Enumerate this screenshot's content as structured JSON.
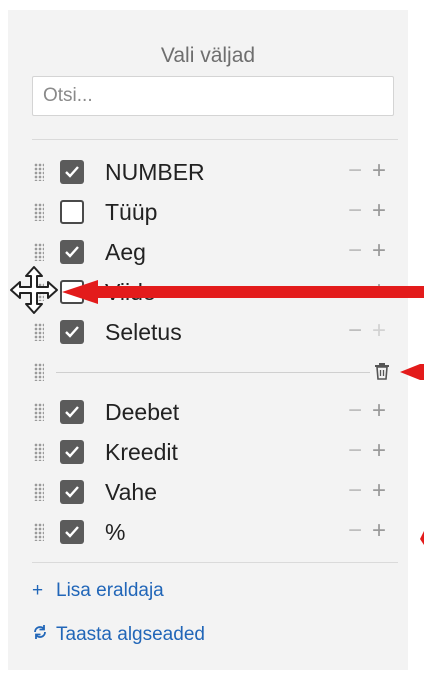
{
  "panel": {
    "title": "Vali väljad",
    "search_placeholder": "Otsi..."
  },
  "fields": [
    {
      "label": "NUMBER",
      "checked": true
    },
    {
      "label": "Tüüp",
      "checked": false
    },
    {
      "label": "Aeg",
      "checked": true
    },
    {
      "label": "Viide",
      "checked": false
    },
    {
      "label": "Seletus",
      "checked": true
    }
  ],
  "separator": {
    "delete_icon": "trash-icon"
  },
  "fields_after": [
    {
      "label": "Deebet",
      "checked": true
    },
    {
      "label": "Kreedit",
      "checked": true
    },
    {
      "label": "Vahe",
      "checked": true
    },
    {
      "label": "%",
      "checked": true
    }
  ],
  "controls": {
    "minus": "−",
    "plus": "+"
  },
  "footer": {
    "add_separator_icon": "+",
    "add_separator": "Lisa eraldaja",
    "reset_icon": "refresh-icon",
    "reset": "Taasta algseaded"
  },
  "colors": {
    "accent": "#2166b8",
    "annotation_arrow": "#e31b1b",
    "checkbox_checked": "#5b5b5b"
  },
  "icons": [
    "drag-handle-icon",
    "checkbox-icon",
    "move-cursor-icon",
    "trash-icon",
    "refresh-icon",
    "annotation-arrow-icon"
  ]
}
